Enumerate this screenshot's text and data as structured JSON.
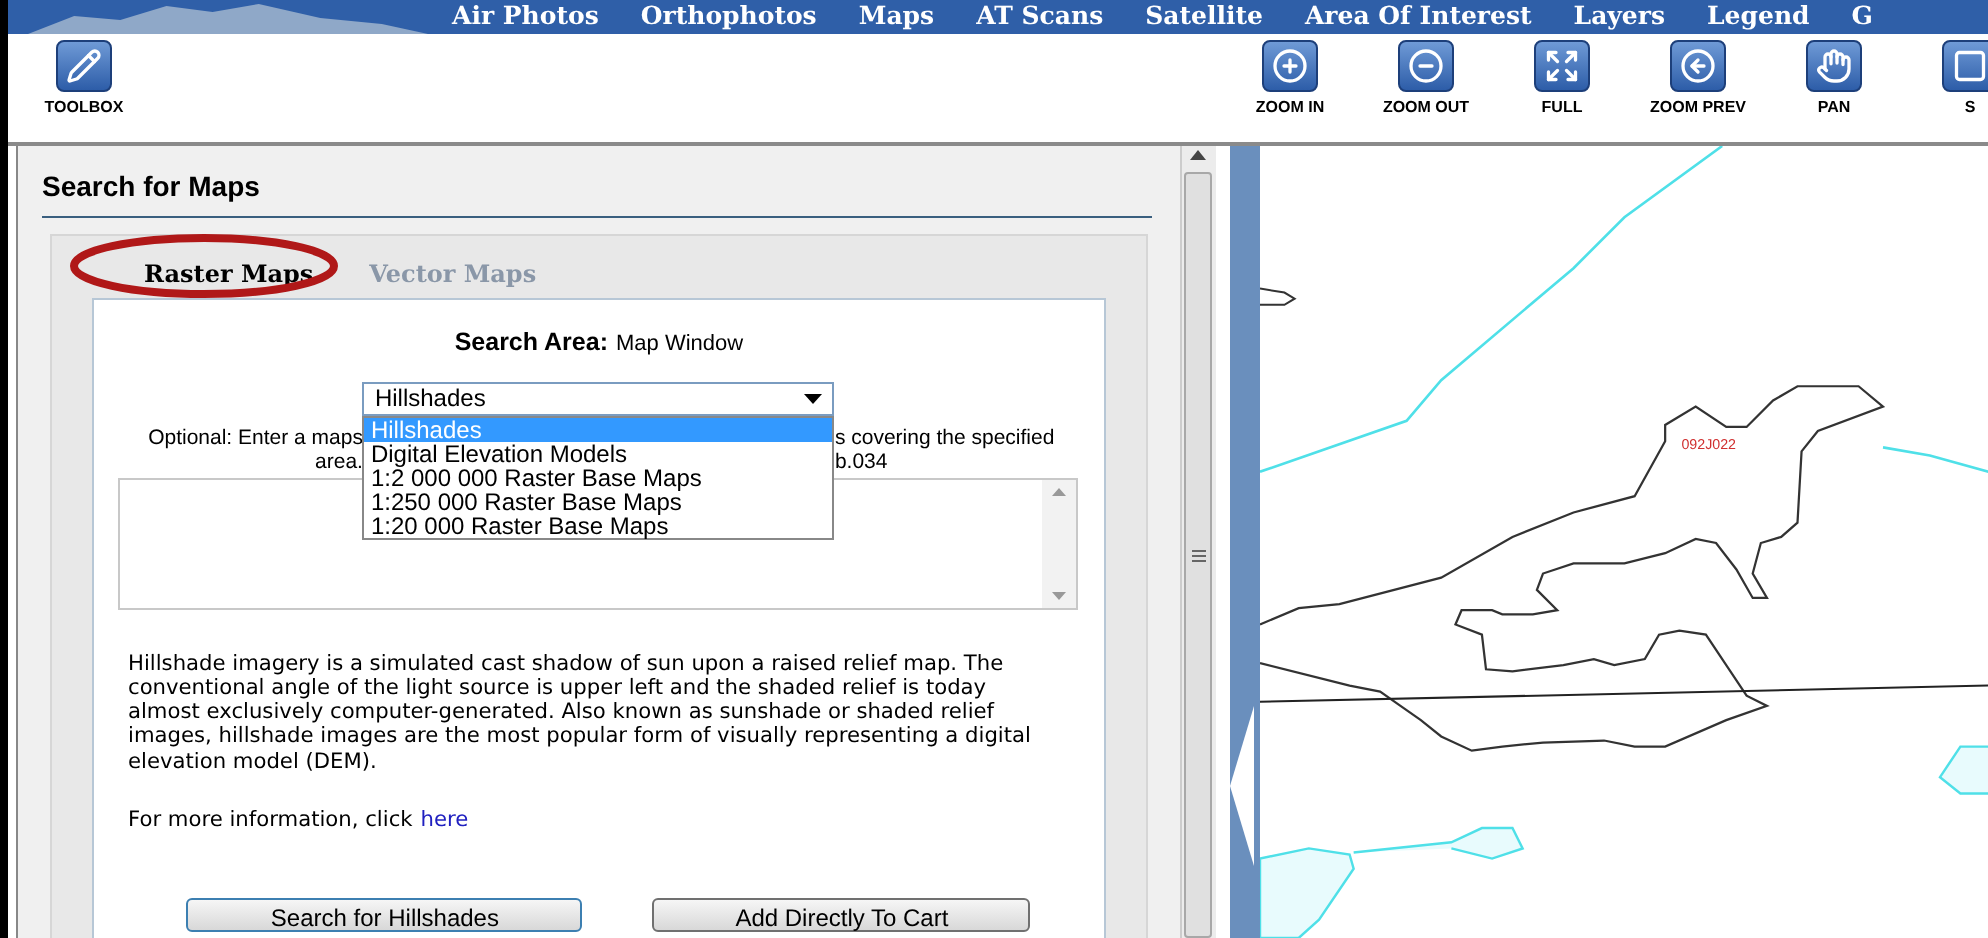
{
  "nav": {
    "items": [
      {
        "label": "Air Photos"
      },
      {
        "label": "Orthophotos"
      },
      {
        "label": "Maps"
      },
      {
        "label": "AT Scans"
      },
      {
        "label": "Satellite"
      },
      {
        "label": "Area Of Interest"
      },
      {
        "label": "Layers"
      },
      {
        "label": "Legend"
      },
      {
        "label": "G"
      }
    ]
  },
  "toolbar": {
    "left": [
      {
        "label": "TOOLBOX",
        "kind": "toolbox"
      }
    ],
    "right": [
      {
        "label": "ZOOM IN",
        "kind": "zoom-in"
      },
      {
        "label": "ZOOM OUT",
        "kind": "zoom-out"
      },
      {
        "label": "FULL",
        "kind": "full"
      },
      {
        "label": "ZOOM PREV",
        "kind": "zoom-prev"
      },
      {
        "label": "PAN",
        "kind": "pan"
      },
      {
        "label": "S",
        "kind": "generic"
      }
    ]
  },
  "panel": {
    "title": "Search for Maps",
    "tabs": [
      {
        "label": "Raster Maps",
        "selected": true
      },
      {
        "label": "Vector Maps",
        "selected": false
      }
    ],
    "search_area": {
      "label": "Search Area:",
      "value": "Map Window"
    },
    "dropdown": {
      "value": "Hillshades",
      "expanded": true,
      "options": [
        {
          "label": "Hillshades",
          "selected": true
        },
        {
          "label": "Digital Elevation Models",
          "selected": false
        },
        {
          "label": "1:2 000 000 Raster Base Maps",
          "selected": false
        },
        {
          "label": "1:250 000 Raster Base Maps",
          "selected": false
        },
        {
          "label": "1:20 000 Raster Base Maps",
          "selected": false
        }
      ]
    },
    "optional_text": {
      "line1_left": "Optional: Enter a maps",
      "line1_right": "s covering the specified",
      "line2_left": "area.",
      "line2_right": "b.034"
    },
    "description": "Hillshade imagery is a simulated cast shadow of sun upon a raised relief map. The conventional angle of the light source is upper left and the shaded relief is today almost exclusively computer-generated. Also known as sunshade or shaded relief images, hillshade images are the most popular form of visually representing a digital elevation model (DEM).",
    "more_info": {
      "text": "For more information, click",
      "link": "here"
    },
    "buttons": [
      {
        "label": "Search for Hillshades",
        "kind": "primary"
      },
      {
        "label": "Add Directly To Cart",
        "kind": "secondary"
      }
    ]
  },
  "map": {
    "label": "092J022"
  }
}
